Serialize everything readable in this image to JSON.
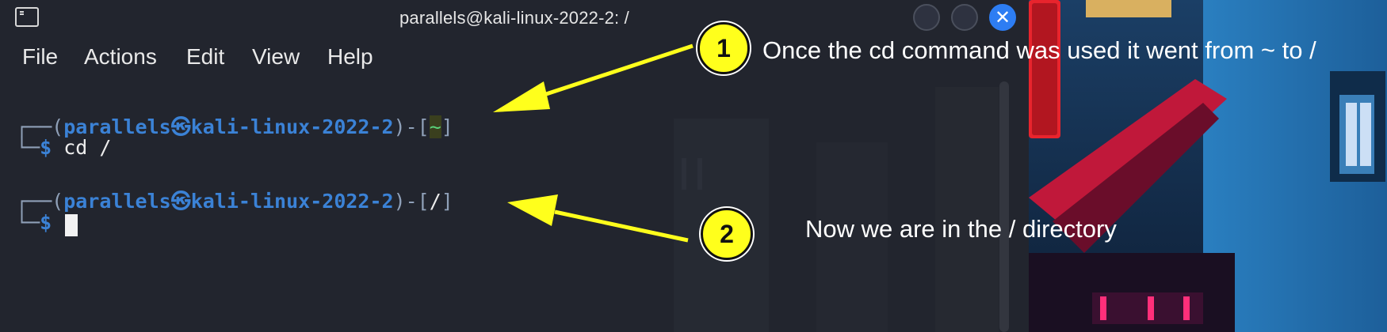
{
  "window": {
    "title": "parallels@kali-linux-2022-2: /",
    "close_glyph": "✕"
  },
  "menu": [
    "File",
    "Actions",
    "Edit",
    "View",
    "Help"
  ],
  "terminal": {
    "box_top": "┌──(",
    "box_bottom": "└─",
    "user": "parallels",
    "at_symbol": "㉿",
    "host": "kali-linux-2022-2",
    "dir_open": ")-[",
    "dir_close": "]",
    "first_dir": "~",
    "second_dir": "/",
    "prompt_symbol": "$",
    "command": "cd /"
  },
  "annotations": [
    {
      "number": "1",
      "text": "Once the cd command was used it went from ~ to /"
    },
    {
      "number": "2",
      "text": "Now we are in the / directory"
    }
  ],
  "colors": {
    "terminal_bg": "#22252e",
    "prompt_blue": "#3b82d6",
    "dir_green": "#5ad27a",
    "callout_yellow": "#ffff1c",
    "close_button": "#2d7df3"
  }
}
